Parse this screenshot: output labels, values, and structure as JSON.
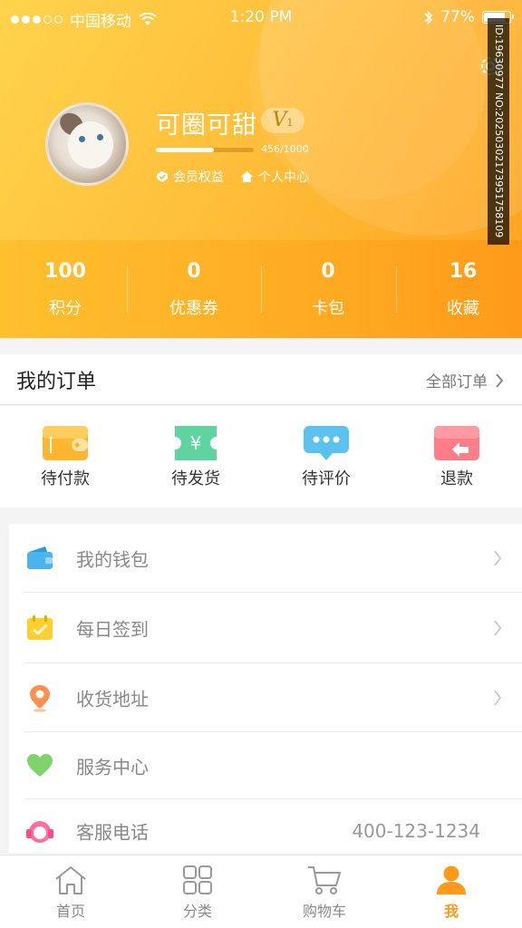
{
  "status_bar": {
    "carrier": "中国移动",
    "time": "1:20 PM",
    "battery": "77%"
  },
  "profile": {
    "username": "可圈可甜",
    "vip_level": "V",
    "vip_sub": "1",
    "progress_text": "456/1000",
    "progress_fraction": 0.456,
    "links": [
      "会员权益",
      "个人中心"
    ]
  },
  "stats": [
    {
      "value": "100",
      "label": "积分"
    },
    {
      "value": "0",
      "label": "优惠券"
    },
    {
      "value": "0",
      "label": "卡包"
    },
    {
      "value": "16",
      "label": "收藏"
    }
  ],
  "orders": {
    "title": "我的订单",
    "all_label": "全部订单",
    "items": [
      {
        "label": "待付款",
        "icon": "wallet-card-icon",
        "color": "#ffb52e"
      },
      {
        "label": "待发货",
        "icon": "yen-ticket-icon",
        "color": "#5fd3a0"
      },
      {
        "label": "待评价",
        "icon": "chat-bubble-icon",
        "color": "#5bc2ef"
      },
      {
        "label": "退款",
        "icon": "refund-card-icon",
        "color": "#ff7d86"
      }
    ]
  },
  "menu": [
    {
      "label": "我的钱包",
      "icon": "wallet-icon",
      "color": "#4bb4ec",
      "value": ""
    },
    {
      "label": "每日签到",
      "icon": "calendar-check-icon",
      "color": "#ffd02e",
      "value": ""
    },
    {
      "label": "收货地址",
      "icon": "location-pin-icon",
      "color": "#ff8f4f",
      "value": ""
    },
    {
      "label": "服务中心",
      "icon": "heart-icon",
      "color": "#7ed36a",
      "value": ""
    },
    {
      "label": "客服电话",
      "icon": "headset-icon",
      "color": "#ff6fa0",
      "value": "400-123-1234"
    }
  ],
  "tabbar": [
    {
      "label": "首页",
      "icon": "home-icon"
    },
    {
      "label": "分类",
      "icon": "grid-icon"
    },
    {
      "label": "购物车",
      "icon": "cart-icon"
    },
    {
      "label": "我",
      "icon": "user-icon",
      "active": true
    }
  ],
  "watermark": "ID:19630977 NO:20250302173951758109"
}
